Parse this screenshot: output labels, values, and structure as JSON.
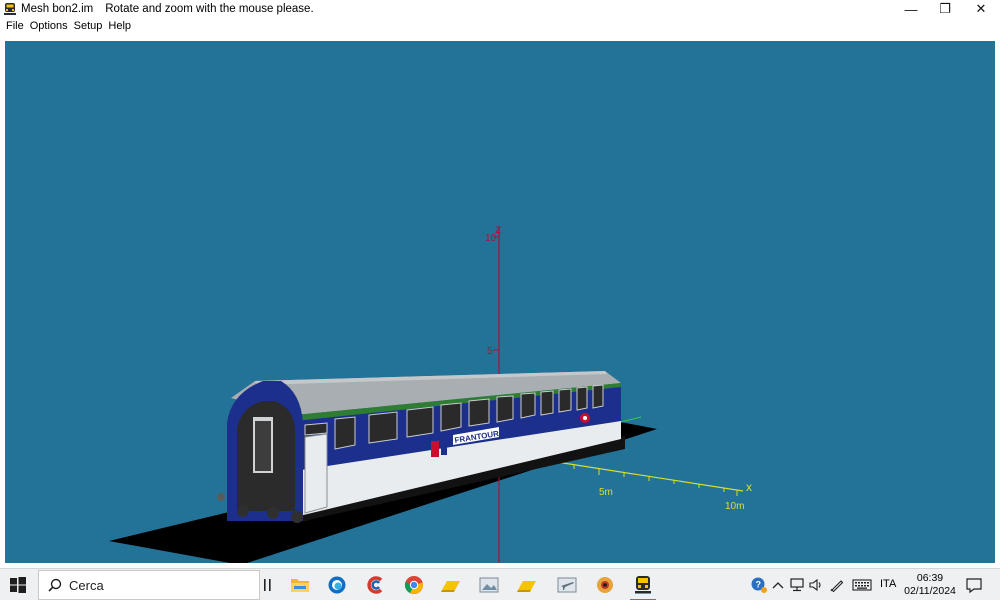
{
  "window": {
    "title": "Mesh bon2.im",
    "hint": "Rotate and zoom with the mouse please.",
    "controls": {
      "minimize": "—",
      "restore": "❐",
      "close": "✕"
    }
  },
  "menu": [
    "File",
    "Options",
    "Setup",
    "Help"
  ],
  "viewport": {
    "background": "#237297",
    "axes": {
      "z_label": "z",
      "x_label": "x",
      "z_ticks": [
        "10",
        "5"
      ],
      "x_ticks": [
        "5m",
        "10m"
      ],
      "z_color": "#a4143c",
      "x_color": "#d6e02a",
      "y_color": "#35d23f"
    },
    "model": {
      "name": "passenger-coach",
      "livery_text": "FRANTOUR",
      "body_colors": {
        "roof": "#a8aeb1",
        "band": "#1d2f8c",
        "side": "#e9ecee",
        "stripe": "#2e7d32"
      }
    }
  },
  "taskbar": {
    "search_placeholder": "Cerca",
    "apps": [
      "task-view",
      "file-explorer",
      "edge",
      "ccleaner",
      "chrome",
      "folder-yellow",
      "image-viewer",
      "folder-yellow-2",
      "airplane-app",
      "eye-app",
      "train-app"
    ],
    "tray": {
      "language": "ITA",
      "time": "06:39",
      "date": "02/11/2024"
    }
  }
}
